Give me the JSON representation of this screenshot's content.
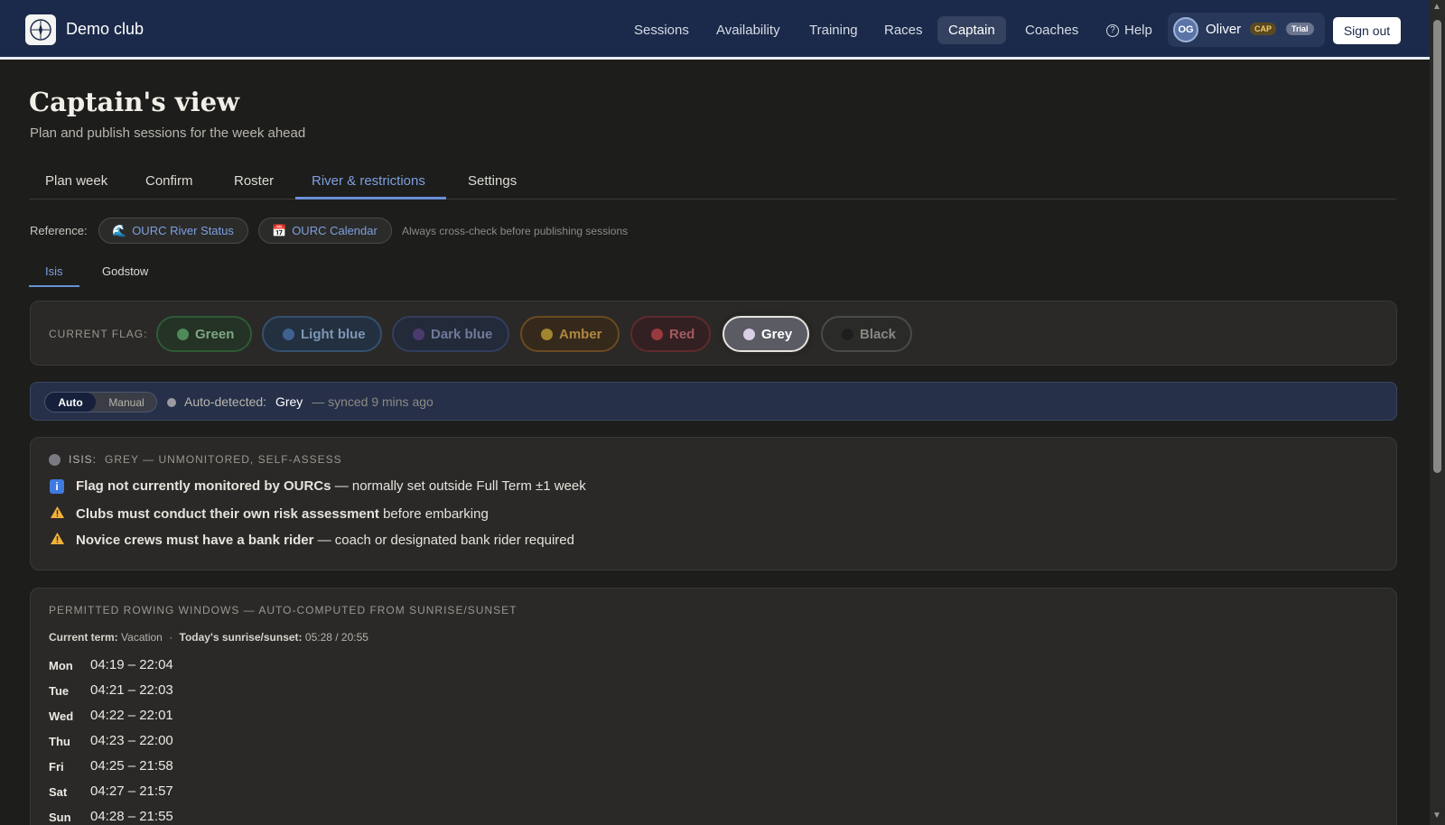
{
  "header": {
    "brand": "Demo club",
    "nav": [
      "Sessions",
      "Availability",
      "Training",
      "Races",
      "Captain",
      "Coaches",
      "Help"
    ],
    "user": {
      "initials": "OG",
      "name": "Oliver",
      "role_badge": "CAP",
      "plan_badge": "Trial"
    },
    "signout": "Sign out"
  },
  "page": {
    "title": "Captain's view",
    "subtitle": "Plan and publish sessions for the week ahead"
  },
  "tabs": [
    "Plan week",
    "Confirm",
    "Roster",
    "River & restrictions",
    "Settings"
  ],
  "reference": {
    "label": "Reference:",
    "links": [
      "OURC River Status",
      "OURC Calendar"
    ],
    "note": "Always cross-check before publishing sessions"
  },
  "rivers": [
    "Isis",
    "Godstow"
  ],
  "flag": {
    "label": "CURRENT FLAG:",
    "options": [
      "Green",
      "Light blue",
      "Dark blue",
      "Amber",
      "Red",
      "Grey",
      "Black"
    ],
    "selected": "Grey"
  },
  "auto": {
    "mode_auto": "Auto",
    "mode_manual": "Manual",
    "detected_label": "Auto-detected:",
    "detected_value": "Grey",
    "synced": "— synced 9 mins ago"
  },
  "status": {
    "river": "ISIS:",
    "summary": "GREY — UNMONITORED, SELF-ASSESS",
    "lines": [
      {
        "bold": "Flag not currently monitored by OURCs",
        "rest": " — normally set outside Full Term ±1 week"
      },
      {
        "bold": "Clubs must conduct their own risk assessment",
        "rest": " before embarking"
      },
      {
        "bold": "Novice crews must have a bank rider",
        "rest": " — coach or designated bank rider required"
      }
    ]
  },
  "windows": {
    "title": "PERMITTED ROWING WINDOWS — AUTO-COMPUTED FROM SUNRISE/SUNSET",
    "term_label": "Current term:",
    "term_value": "Vacation",
    "sun_label": "Today's sunrise/sunset:",
    "sun_value": "05:28 / 20:55",
    "days": [
      {
        "day": "Mon",
        "time": "04:19 – 22:04"
      },
      {
        "day": "Tue",
        "time": "04:21 – 22:03"
      },
      {
        "day": "Wed",
        "time": "04:22 – 22:01"
      },
      {
        "day": "Thu",
        "time": "04:23 – 22:00"
      },
      {
        "day": "Fri",
        "time": "04:25 – 21:58"
      },
      {
        "day": "Sat",
        "time": "04:27 – 21:57"
      },
      {
        "day": "Sun",
        "time": "04:28 – 21:55"
      }
    ]
  },
  "colors": {
    "nav_bg": "#1b2a4a",
    "accent": "#7e9fe0",
    "page_bg": "#1d1d1b",
    "panel_bg": "#2a2927"
  }
}
